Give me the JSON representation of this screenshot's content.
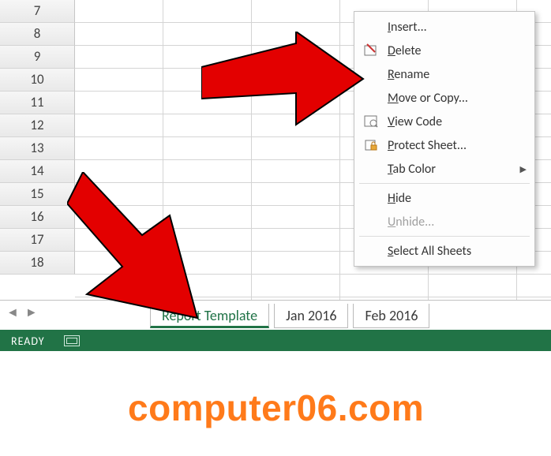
{
  "rows": [
    "7",
    "8",
    "9",
    "10",
    "11",
    "12",
    "13",
    "14",
    "15",
    "16",
    "17",
    "18"
  ],
  "tabs": {
    "active": "Report Template",
    "others": [
      "Jan 2016",
      "Feb 2016"
    ]
  },
  "status": {
    "text": "READY"
  },
  "menu": {
    "insert": "Insert...",
    "delete": "Delete",
    "rename": "Rename",
    "move_copy": "Move or Copy...",
    "view_code": "View Code",
    "protect": "Protect Sheet...",
    "tab_color": "Tab Color",
    "hide": "Hide",
    "unhide": "Unhide...",
    "select_all": "Select All Sheets"
  },
  "watermark": "computer06.com"
}
